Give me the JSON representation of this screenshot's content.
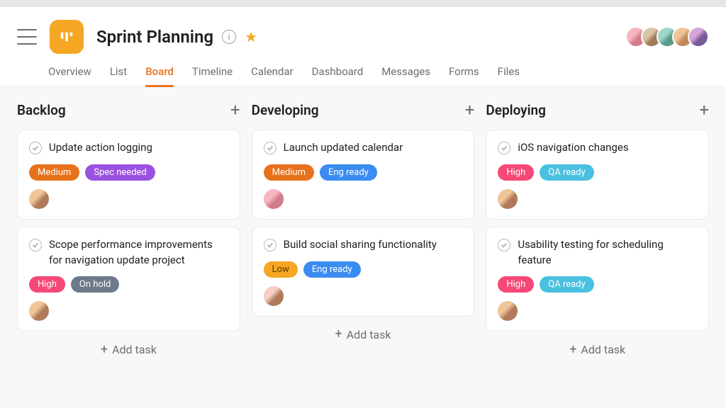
{
  "page": {
    "title": "Sprint Planning"
  },
  "tabs": {
    "overview": "Overview",
    "list": "List",
    "board": "Board",
    "timeline": "Timeline",
    "calendar": "Calendar",
    "dashboard": "Dashboard",
    "messages": "Messages",
    "forms": "Forms",
    "files": "Files"
  },
  "columns": {
    "backlog": {
      "title": "Backlog",
      "add": "Add task",
      "cards": [
        {
          "title": "Update action logging",
          "tags": [
            "Medium",
            "Spec needed"
          ]
        },
        {
          "title": "Scope performance improvements for navigation update project",
          "tags": [
            "High",
            "On hold"
          ]
        }
      ]
    },
    "developing": {
      "title": "Developing",
      "add": "Add task",
      "cards": [
        {
          "title": "Launch updated calendar",
          "tags": [
            "Medium",
            "Eng ready"
          ]
        },
        {
          "title": "Build social sharing functionality",
          "tags": [
            "Low",
            "Eng ready"
          ]
        }
      ]
    },
    "deploying": {
      "title": "Deploying",
      "add": "Add task",
      "cards": [
        {
          "title": "iOS navigation changes",
          "tags": [
            "High",
            "QA ready"
          ]
        },
        {
          "title": "Usability testing for scheduling feature",
          "tags": [
            "High",
            "QA ready"
          ]
        }
      ]
    }
  }
}
